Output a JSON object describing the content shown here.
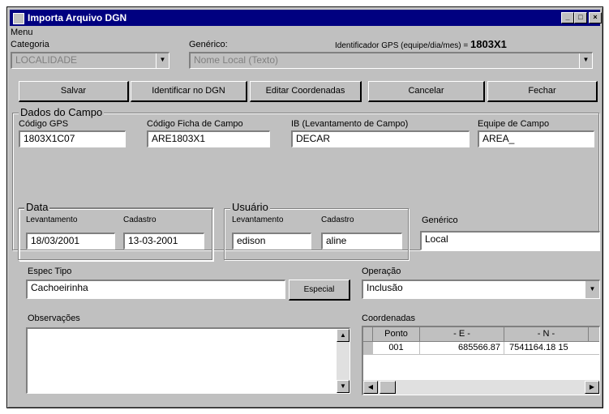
{
  "window": {
    "title": "Importa Arquivo DGN",
    "menu_label": "Menu"
  },
  "top": {
    "categoria_label": "Categoria",
    "categoria_value": "LOCALIDADE",
    "generico_label": "Genérico:",
    "generico_value": "Nome Local (Texto)",
    "gps_id_label": "Identificador GPS (equipe/dia/mes) =",
    "gps_id_value": "1803X1"
  },
  "toolbar": {
    "salvar": "Salvar",
    "identificar": "Identificar no DGN",
    "editar": "Editar Coordenadas",
    "cancelar": "Cancelar",
    "fechar": "Fechar"
  },
  "dados": {
    "group_title": "Dados do Campo",
    "codigo_gps_label": "Código GPS",
    "codigo_gps_value": "1803X1C07",
    "codigo_ficha_label": "Código Ficha de Campo",
    "codigo_ficha_value": "ARE1803X1",
    "ib_label": "IB (Levantamento de Campo)",
    "ib_value": "DECAR",
    "equipe_label": "Equipe de Campo",
    "equipe_value": "AREA_",
    "data_group": "Data",
    "data_lev_label": "Levantamento",
    "data_lev_value": "18/03/2001",
    "data_cad_label": "Cadastro",
    "data_cad_value": "13-03-2001",
    "usuario_group": "Usuário",
    "usu_lev_label": "Levantamento",
    "usu_lev_value": "edison",
    "usu_cad_label": "Cadastro",
    "usu_cad_value": "aline",
    "generico_label": "Genérico",
    "generico_value": "Local"
  },
  "bottom": {
    "espec_tipo_label": "Espec Tipo",
    "espec_tipo_value": "Cachoeirinha",
    "espec_btn": "Especial",
    "operacao_label": "Operação",
    "operacao_value": "Inclusão",
    "observacoes_label": "Observações",
    "coordenadas_label": "Coordenadas",
    "coord_headers": [
      "Ponto",
      "- E -",
      "- N -"
    ],
    "coord_rows": [
      [
        "001",
        "685566.87",
        "7541164.18 15"
      ]
    ]
  },
  "colors": {
    "title_bar": "#000080",
    "face": "#c0c0c0"
  }
}
